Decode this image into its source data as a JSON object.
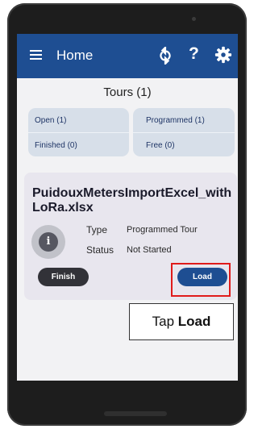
{
  "app": {
    "title": "Home",
    "icons": [
      "menu-icon",
      "sync-icon",
      "help-icon",
      "gear-icon"
    ],
    "help_glyph": "?"
  },
  "tours": {
    "heading": "Tours (1)",
    "tiles": [
      {
        "label": "Open (1)"
      },
      {
        "label": "Programmed (1)"
      },
      {
        "label": "Finished (0)"
      },
      {
        "label": "Free (0)"
      }
    ]
  },
  "tour_card": {
    "file_name": "PuidouxMetersImportExcel_withLoRa.xlsx",
    "type_label": "Type",
    "type_value": "Programmed Tour",
    "status_label": "Status",
    "status_value": "Not Started",
    "info_glyph": "i",
    "finish_label": "Finish",
    "load_label": "Load"
  },
  "instruction": {
    "prefix": "Tap ",
    "emphasis": "Load"
  },
  "colors": {
    "appbar": "#1e4e92",
    "tile_bg": "#d7dfe9",
    "highlight": "#e01b1b",
    "finish_button": "#323238"
  }
}
